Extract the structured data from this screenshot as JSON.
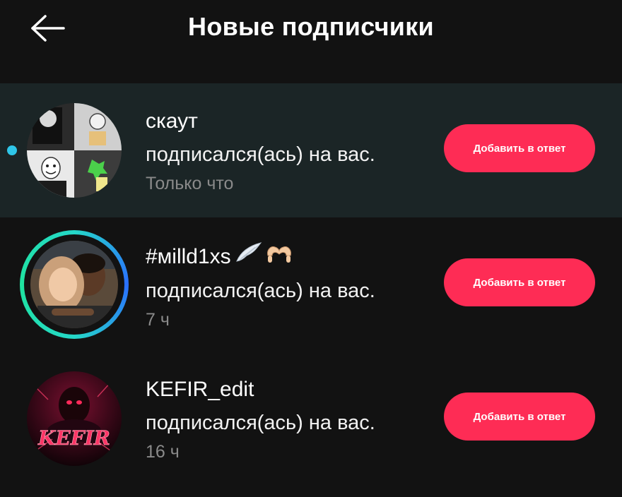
{
  "header": {
    "title": "Новые подписчики",
    "back_icon": "arrow-left-icon"
  },
  "followers": [
    {
      "username": "скаут",
      "action": "подписался(ась) на вас.",
      "time": "Только что",
      "button": "Добавить в ответ",
      "unread": true
    },
    {
      "username": "#мilld1xs",
      "action": "подписался(ась) на вас.",
      "time": "7 ч",
      "button": "Добавить в ответ",
      "unread": false,
      "emojis": [
        "wing-icon",
        "heart-hands-icon"
      ]
    },
    {
      "username": "KEFIR_edit",
      "action": "подписался(ась) на вас.",
      "time": "16 ч",
      "button": "Добавить в ответ",
      "unread": false,
      "avatar_text": "KEFIR"
    }
  ],
  "colors": {
    "background": "#121212",
    "unread_row": "#1b2526",
    "accent": "#fe2c55",
    "unread_dot": "#2fc6e8",
    "secondary_text": "#8a8a8a"
  }
}
